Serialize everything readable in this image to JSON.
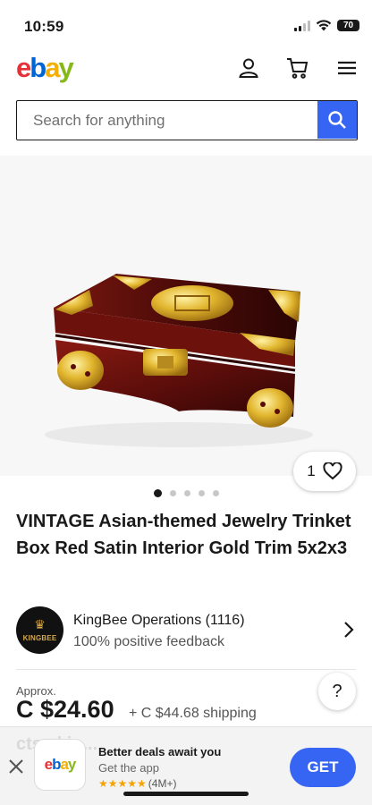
{
  "status": {
    "time": "10:59",
    "battery": "70"
  },
  "header": {
    "logo": [
      "e",
      "b",
      "a",
      "y"
    ]
  },
  "search": {
    "placeholder": "Search for anything"
  },
  "listing": {
    "watch_count": "1",
    "image_count_dots": 5,
    "active_image": 1,
    "title": "VINTAGE Asian-themed Jewelry Trinket Box Red Satin Interior Gold Trim 5x2x3"
  },
  "seller": {
    "name": "KingBee Operations (1116)",
    "feedback": "100% positive feedback",
    "avatar_text": "KINGBEE"
  },
  "price": {
    "approx_label": "Approx.",
    "amount": "C $24.60",
    "shipping": "+ C $44.68 shipping"
  },
  "help": {
    "label": "?"
  },
  "app_banner": {
    "title": "Better deals await you",
    "subtitle": "Get the app",
    "rating_count": "(4M+)",
    "get_label": "GET",
    "ghost_text": "cts skip..."
  },
  "colors": {
    "accent": "#3665f3",
    "ebay_e": "#e53238",
    "ebay_b": "#0064d2",
    "ebay_a": "#f5af02",
    "ebay_y": "#86b817",
    "star": "#f5a300"
  }
}
